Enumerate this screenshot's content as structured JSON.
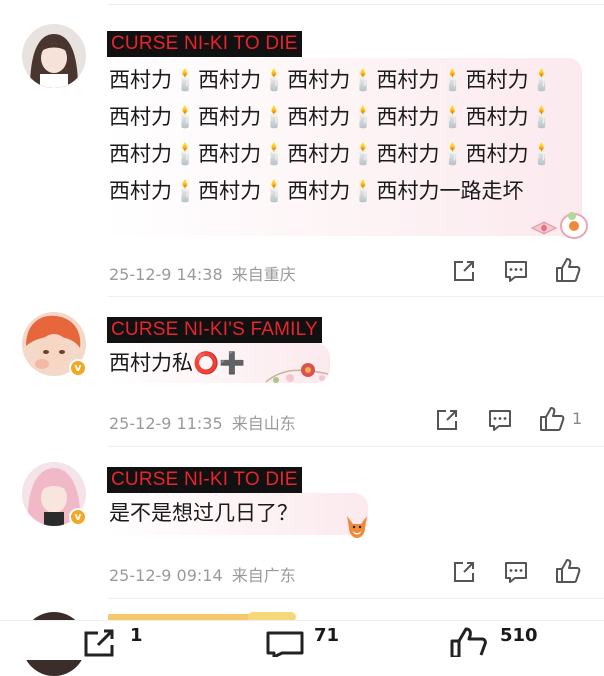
{
  "comments": [
    {
      "badge": "CURSE NI-KI TO DIE",
      "text": "西村力🕯️西村力🕯️西村力🕯️西村力🕯️西村力🕯️西村力🕯️西村力🕯️西村力🕯️西村力🕯️西村力🕯️西村力🕯️西村力🕯️西村力🕯️西村力🕯️西村力🕯️西村力🕯️西村力🕯️西村力🕯️西村力一路走坏",
      "time": "25-12-9 14:38",
      "location": "来自重庆",
      "likes": ""
    },
    {
      "badge": "CURSE NI-KI'S FAMILY",
      "text": "西村力私⭕➕",
      "time": "25-12-9 11:35",
      "location": "来自山东",
      "likes": "1"
    },
    {
      "badge": "CURSE NI-KI TO DIE",
      "text": "是不是想过几日了？",
      "time": "25-12-9 09:14",
      "location": "来自广东",
      "likes": ""
    }
  ],
  "bottom_bar": {
    "share_count": "1",
    "comment_count": "71",
    "like_count": "510"
  },
  "colors": {
    "badge_bg": "#111111",
    "badge_text": "#e8242c",
    "meta_text": "#9a9a9a"
  }
}
